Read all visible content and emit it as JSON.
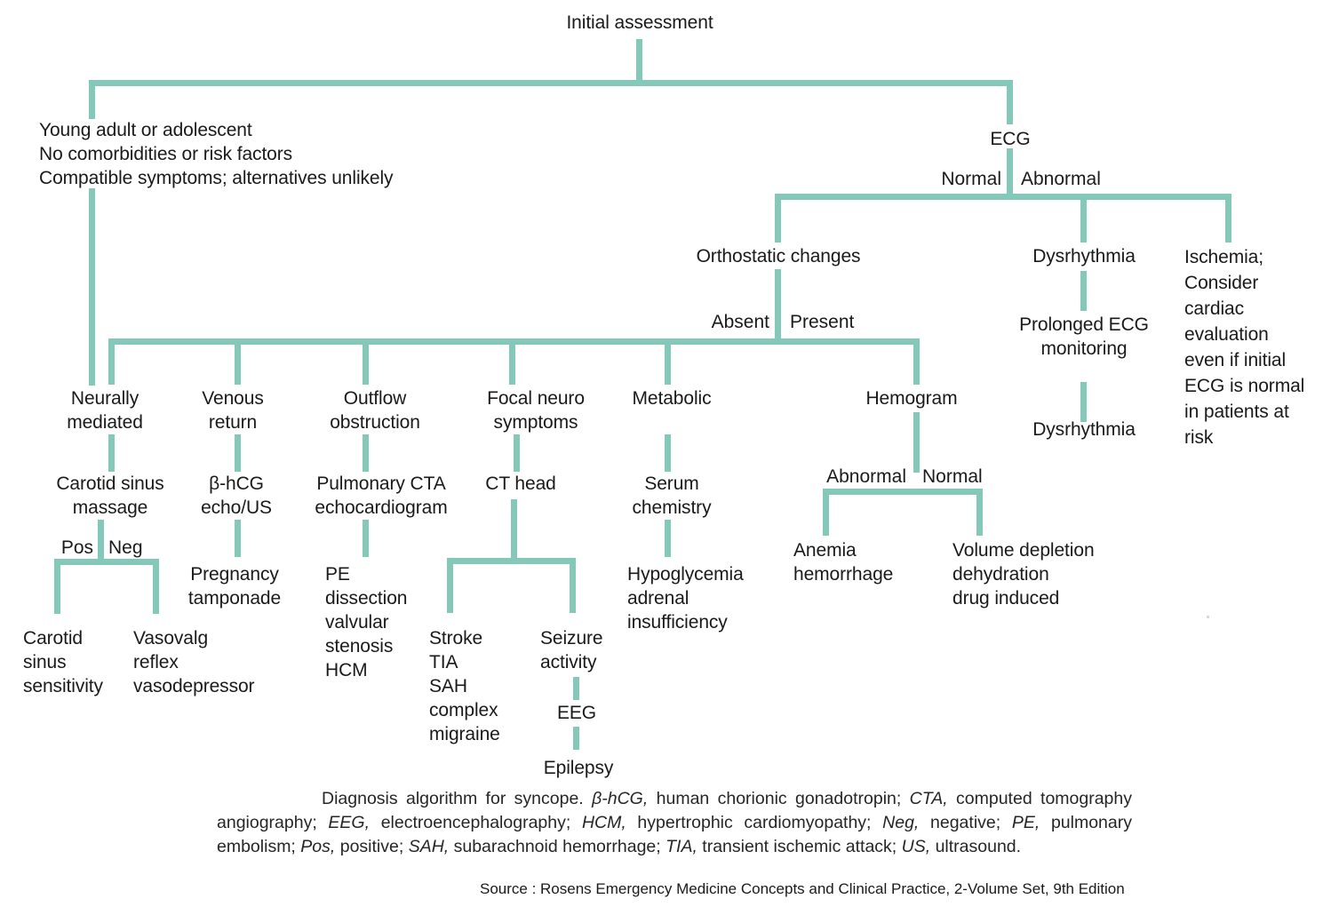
{
  "diagram": {
    "title": "Diagnosis algorithm for syncope",
    "accent_color": "#83c8b8",
    "text_color": "#1a1a1a",
    "nodes": {
      "initial_assessment": "Initial assessment",
      "low_risk_profile": "Young adult or adolescent\nNo comorbidities or risk factors\nCompatible symptoms; alternatives unlikely",
      "ecg": "ECG",
      "orthostatic_changes": "Orthostatic changes",
      "dysrhythmia_top": "Dysrhythmia",
      "ischemia": "Ischemia;\nConsider\ncardiac\nevaluation\neven if initial\nECG is normal\nin patients at\nrisk",
      "prolonged_ecg_monitoring": "Prolonged ECG\nmonitoring",
      "dysrhythmia_bottom": "Dysrhythmia",
      "neurally_mediated": "Neurally\nmediated",
      "venous_return": "Venous\nreturn",
      "outflow_obstruction": "Outflow\nobstruction",
      "focal_neuro_symptoms": "Focal neuro\nsymptoms",
      "metabolic": "Metabolic",
      "hemogram": "Hemogram",
      "carotid_sinus_massage": "Carotid sinus\nmassage",
      "bhcg_echo_us": "β-hCG\necho/US",
      "pulmonary_cta_echo": "Pulmonary CTA\nechocardiogram",
      "ct_head": "CT head",
      "serum_chemistry": "Serum\nchemistry",
      "pregnancy_tamponade": "Pregnancy\ntamponade",
      "pe_dissection": "PE\ndissection\nvalvular\nstenosis\nHCM",
      "hypoglycemia": "Hypoglycemia\nadrenal\ninsufficiency",
      "carotid_sinus_sensitivity": "Carotid\nsinus\nsensitivity",
      "vasovagal_reflex": "Vasovalg\nreflex\nvasodepressor",
      "stroke_tia": "Stroke\nTIA\nSAH\ncomplex\nmigraine",
      "seizure_activity": "Seizure\nactivity",
      "eeg": "EEG",
      "epilepsy": "Epilepsy",
      "anemia_hemorrhage": "Anemia\nhemorrhage",
      "volume_depletion": "Volume depletion\ndehydration\ndrug induced"
    },
    "edge_labels": {
      "ecg_normal": "Normal",
      "ecg_abnormal": "Abnormal",
      "orthostatic_absent": "Absent",
      "orthostatic_present": "Present",
      "csm_pos": "Pos",
      "csm_neg": "Neg",
      "hemogram_abnormal": "Abnormal",
      "hemogram_normal": "Normal"
    }
  },
  "caption": {
    "segments": [
      {
        "text": "Diagnosis algorithm for syncope. ",
        "italic": false
      },
      {
        "text": "β-hCG,",
        "italic": true
      },
      {
        "text": " human chorionic gonadotropin; ",
        "italic": false
      },
      {
        "text": "CTA,",
        "italic": true
      },
      {
        "text": " computed tomography angiography; ",
        "italic": false
      },
      {
        "text": "EEG,",
        "italic": true
      },
      {
        "text": " electroencephalography; ",
        "italic": false
      },
      {
        "text": "HCM,",
        "italic": true
      },
      {
        "text": " hypertrophic cardiomyopathy; ",
        "italic": false
      },
      {
        "text": "Neg,",
        "italic": true
      },
      {
        "text": " negative; ",
        "italic": false
      },
      {
        "text": "PE,",
        "italic": true
      },
      {
        "text": " pulmonary embolism; ",
        "italic": false
      },
      {
        "text": "Pos,",
        "italic": true
      },
      {
        "text": " positive; ",
        "italic": false
      },
      {
        "text": "SAH,",
        "italic": true
      },
      {
        "text": " subarachnoid hemorrhage; ",
        "italic": false
      },
      {
        "text": "TIA,",
        "italic": true
      },
      {
        "text": " transient ischemic attack; ",
        "italic": false
      },
      {
        "text": "US,",
        "italic": true
      },
      {
        "text": " ultrasound.",
        "italic": false
      }
    ],
    "plain_text": "Diagnosis algorithm for syncope. β-hCG, human chorionic gonadotropin; CTA, computed tomography angiography; EEG, electroencephalography; HCM, hypertrophic cardiomyopathy; Neg, negative; PE, pulmonary embolism; Pos, positive; SAH, subarachnoid hemorrhage; TIA, transient ischemic attack; US, ultrasound."
  },
  "source": {
    "label": "Source : Rosens Emergency Medicine Concepts and Clinical Practice, 2-Volume Set, 9th Edition"
  }
}
